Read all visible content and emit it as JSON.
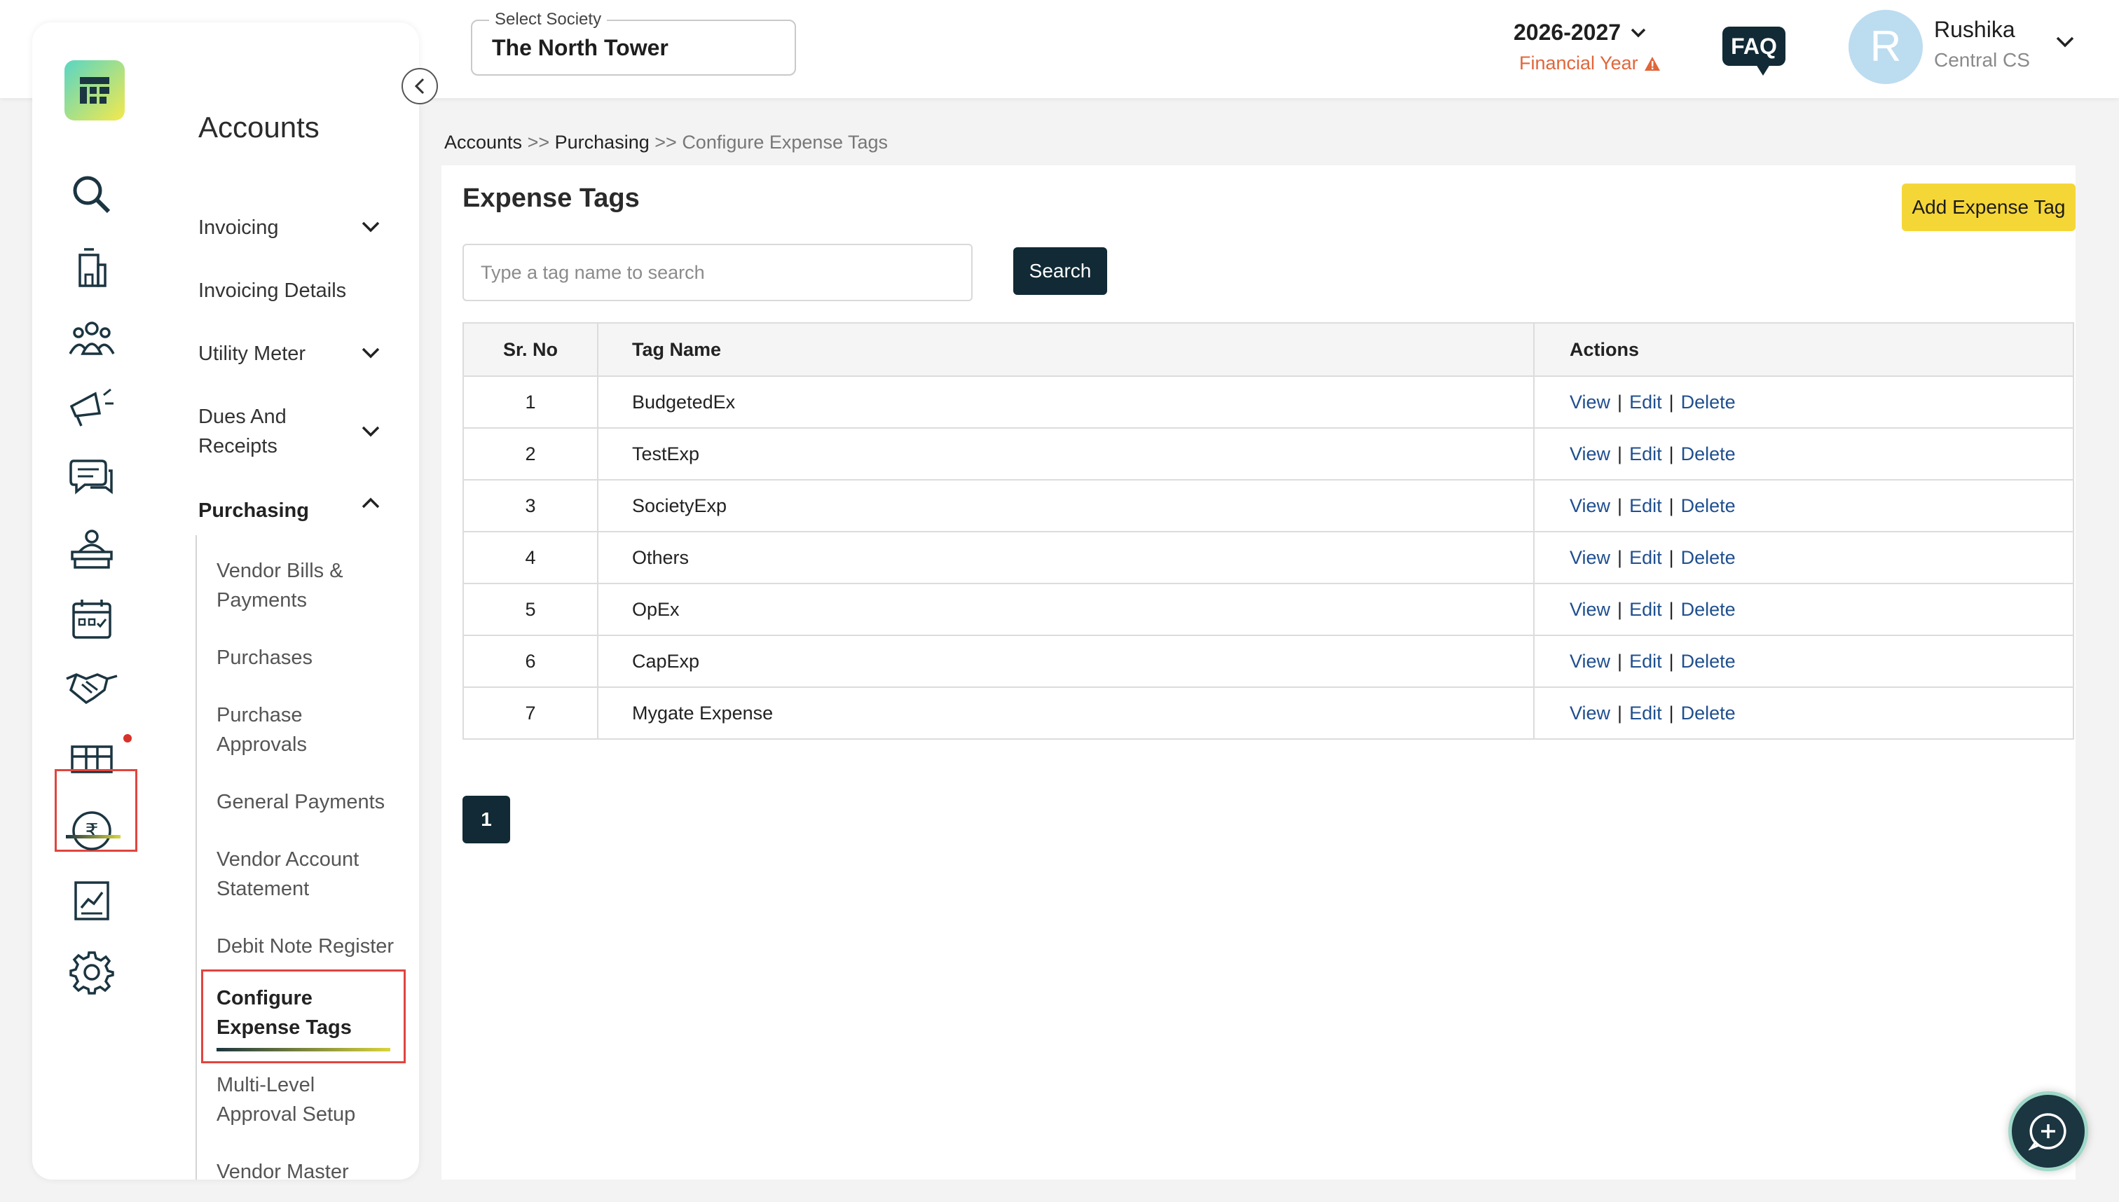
{
  "header": {
    "society_label": "Select Society",
    "society_value": "The North Tower",
    "financial_year": "2026-2027",
    "financial_year_label": "Financial Year",
    "faq": "FAQ",
    "user_initial": "R",
    "user_name": "Rushika",
    "user_role": "Central CS"
  },
  "rail": {
    "icons": [
      "logo-icon",
      "search-icon",
      "building-icon",
      "people-icon",
      "announcement-icon",
      "chat-icon",
      "helpdesk-icon",
      "calendar-icon",
      "handshake-icon",
      "gift-icon",
      "rupee-icon",
      "report-icon",
      "gear-icon"
    ],
    "active": "rupee-icon"
  },
  "sidebar": {
    "title": "Accounts",
    "items": [
      {
        "label": "Invoicing"
      },
      {
        "label": "Invoicing Details"
      },
      {
        "label": "Utility Meter"
      },
      {
        "label": "Dues And Receipts"
      },
      {
        "label": "Purchasing"
      }
    ],
    "sub_items": [
      {
        "label": "Vendor Bills & Payments"
      },
      {
        "label": "Purchases"
      },
      {
        "label": "Purchase Approvals"
      },
      {
        "label": "General Payments"
      },
      {
        "label": "Vendor Account Statement"
      },
      {
        "label": "Debit Note Register"
      },
      {
        "label": "Configure Expense Tags"
      },
      {
        "label": "Multi-Level Approval Setup"
      },
      {
        "label": "Vendor Master"
      }
    ]
  },
  "breadcrumb": {
    "items": [
      "Accounts",
      "Purchasing",
      "Configure Expense Tags"
    ],
    "separator": ">>"
  },
  "main": {
    "title": "Expense Tags",
    "add_button": "Add Expense Tag",
    "search_placeholder": "Type a tag name to search",
    "search_button": "Search",
    "columns": [
      "Sr. No",
      "Tag Name",
      "Actions"
    ],
    "actions": [
      "View",
      "Edit",
      "Delete"
    ],
    "rows": [
      {
        "sr": "1",
        "name": "BudgetedEx"
      },
      {
        "sr": "2",
        "name": "TestExp"
      },
      {
        "sr": "3",
        "name": "SocietyExp"
      },
      {
        "sr": "4",
        "name": "Others"
      },
      {
        "sr": "5",
        "name": "OpEx"
      },
      {
        "sr": "6",
        "name": "CapExp"
      },
      {
        "sr": "7",
        "name": "Mygate Expense"
      }
    ],
    "pagination": [
      "1"
    ]
  },
  "colors": {
    "accent_yellow": "#f5d637",
    "dark_navy": "#112a35",
    "link_blue": "#1f4f8f",
    "warning_orange": "#e0663a",
    "highlight_red": "#e0453e"
  }
}
